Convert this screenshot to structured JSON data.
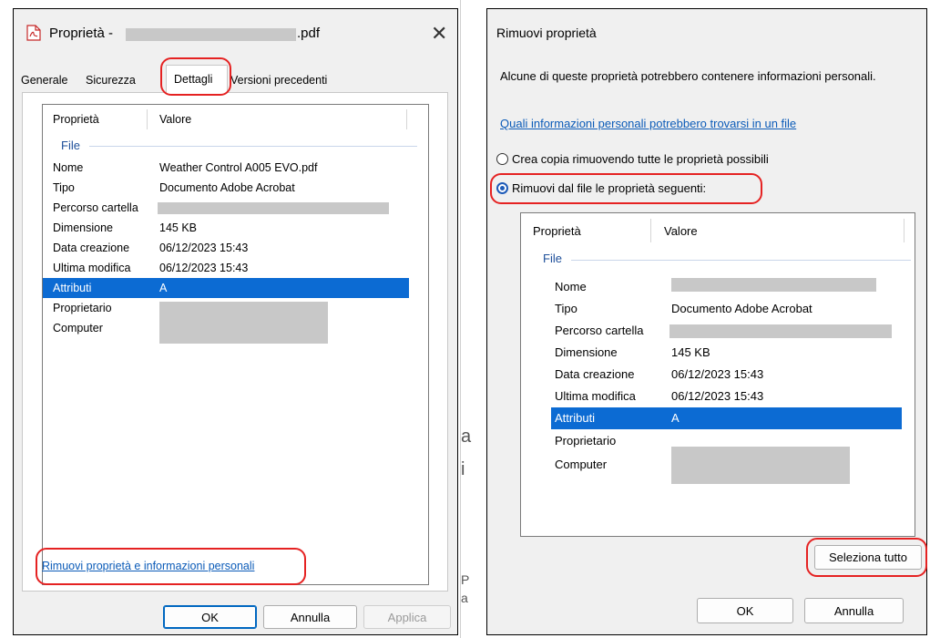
{
  "left_dialog": {
    "title_prefix": "Proprietà -",
    "title_suffix": ".pdf",
    "tabs": [
      "Generale",
      "Sicurezza",
      "Dettagli",
      "Versioni precedenti"
    ],
    "columns": [
      "Proprietà",
      "Valore"
    ],
    "group": "File",
    "rows": [
      {
        "key": "Nome",
        "value": "Weather Control A005 EVO.pdf"
      },
      {
        "key": "Tipo",
        "value": "Documento Adobe Acrobat"
      },
      {
        "key": "Percorso cartella",
        "value": ""
      },
      {
        "key": "Dimensione",
        "value": "145 KB"
      },
      {
        "key": "Data creazione",
        "value": "06/12/2023 15:43"
      },
      {
        "key": "Ultima modifica",
        "value": "06/12/2023 15:43"
      },
      {
        "key": "Attributi",
        "value": "A"
      },
      {
        "key": "Proprietario",
        "value": ""
      },
      {
        "key": "Computer",
        "value": ""
      }
    ],
    "remove_link": "Rimuovi proprietà e informazioni personali",
    "buttons": {
      "ok": "OK",
      "cancel": "Annulla",
      "apply": "Applica"
    }
  },
  "right_dialog": {
    "title": "Rimuovi proprietà",
    "description": "Alcune di queste proprietà potrebbero contenere informazioni personali.",
    "info_link": "Quali informazioni personali potrebbero trovarsi in un file",
    "option_copy": "Crea copia rimuovendo tutte le proprietà possibili",
    "option_remove": "Rimuovi dal file le proprietà seguenti:",
    "columns": [
      "Proprietà",
      "Valore"
    ],
    "group": "File",
    "rows": [
      {
        "key": "Nome",
        "value": ""
      },
      {
        "key": "Tipo",
        "value": "Documento Adobe Acrobat"
      },
      {
        "key": "Percorso cartella",
        "value": ""
      },
      {
        "key": "Dimensione",
        "value": "145 KB"
      },
      {
        "key": "Data creazione",
        "value": "06/12/2023 15:43"
      },
      {
        "key": "Ultima modifica",
        "value": "06/12/2023 15:43"
      },
      {
        "key": "Attributi",
        "value": "A"
      },
      {
        "key": "Proprietario",
        "value": ""
      },
      {
        "key": "Computer",
        "value": ""
      }
    ],
    "select_all": "Seleziona tutto",
    "buttons": {
      "ok": "OK",
      "cancel": "Annulla"
    }
  },
  "background": {
    "fragment_a": "a",
    "fragment_i": "i",
    "fragment_p": "P",
    "fragment_dot": "a"
  },
  "colors": {
    "accent": "#0c6bd3",
    "highlight_ring": "#e52222",
    "link": "#0b5bb8"
  },
  "icons": {
    "pdf": "pdf-file-icon",
    "close": "close-icon"
  }
}
